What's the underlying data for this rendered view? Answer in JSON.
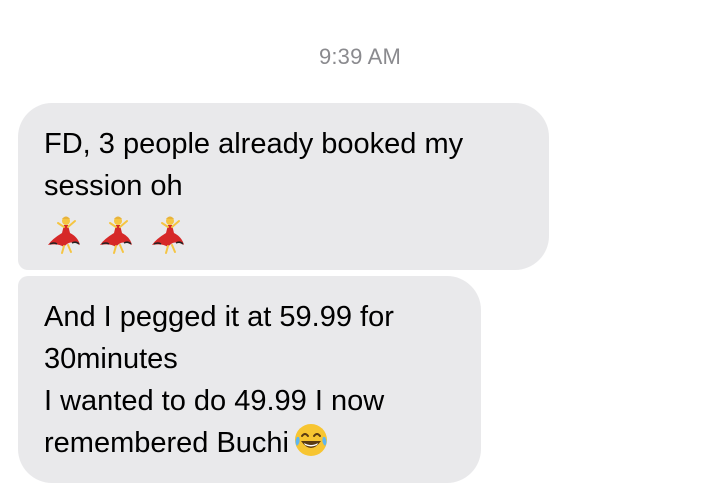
{
  "timestamp": "9:39 AM",
  "messages": [
    {
      "lines": [
        "FD, 3 people already booked my",
        "session oh"
      ],
      "emojis": [
        "dancer-icon",
        "dancer-icon",
        "dancer-icon"
      ]
    },
    {
      "lines": [
        "And I pegged it at 59.99 for",
        "30minutes",
        "I wanted to do 49.99 I now",
        "remembered Buchi"
      ],
      "trailing_emoji": "tears-of-joy-icon"
    }
  ],
  "colors": {
    "bubble": "#e9e9eb",
    "timestamp": "#8a8a8e",
    "text": "#000000",
    "dancer_dress": "#d62828",
    "emoji_face": "#f7c531"
  }
}
